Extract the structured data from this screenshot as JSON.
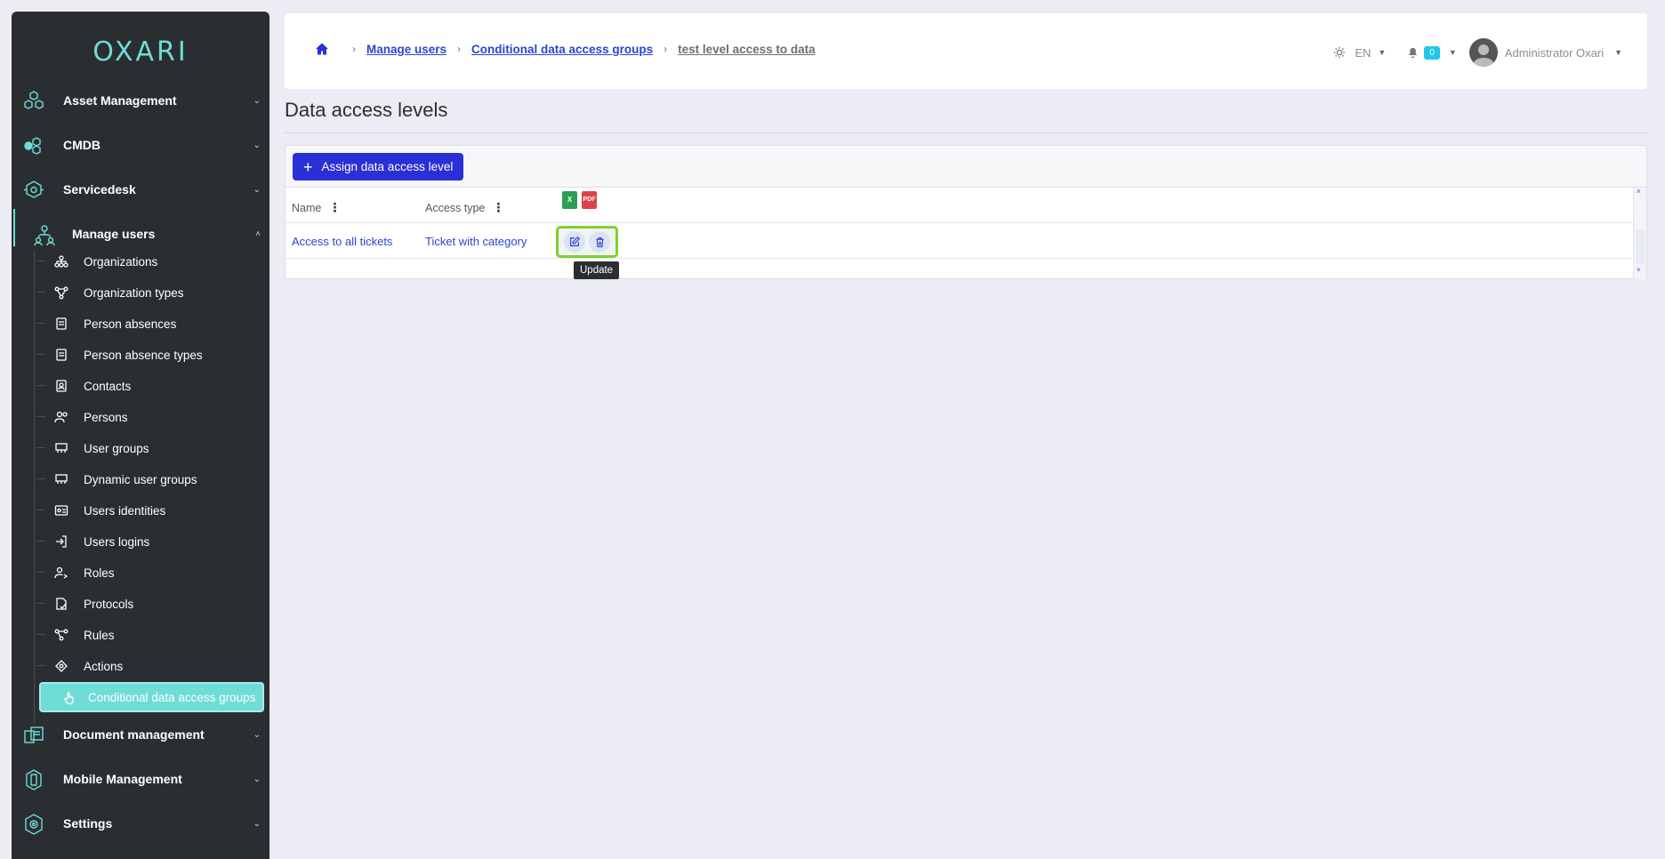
{
  "logo": "OXARI",
  "sidebar": {
    "sections": [
      {
        "label": "Asset Management",
        "icon": "hexagons-icon"
      },
      {
        "label": "CMDB",
        "icon": "cmdb-icon"
      },
      {
        "label": "Servicedesk",
        "icon": "eye-hexagon-icon"
      },
      {
        "label": "Manage users",
        "icon": "users-tree-icon"
      }
    ],
    "sub_items": [
      {
        "label": "Organizations",
        "icon": "org-chart-icon"
      },
      {
        "label": "Organization types",
        "icon": "org-types-icon"
      },
      {
        "label": "Person absences",
        "icon": "document-icon"
      },
      {
        "label": "Person absence types",
        "icon": "document-icon"
      },
      {
        "label": "Contacts",
        "icon": "contact-card-icon"
      },
      {
        "label": "Persons",
        "icon": "persons-icon"
      },
      {
        "label": "User groups",
        "icon": "user-groups-icon"
      },
      {
        "label": "Dynamic user groups",
        "icon": "user-groups-icon"
      },
      {
        "label": "Users identities",
        "icon": "id-card-icon"
      },
      {
        "label": "Users logins",
        "icon": "login-icon"
      },
      {
        "label": "Roles",
        "icon": "role-icon"
      },
      {
        "label": "Protocols",
        "icon": "protocol-icon"
      },
      {
        "label": "Rules",
        "icon": "rules-icon"
      },
      {
        "label": "Actions",
        "icon": "actions-icon"
      },
      {
        "label": "Conditional data access groups",
        "icon": "hand-pointer-icon"
      }
    ],
    "bottom_sections": [
      {
        "label": "Document management",
        "icon": "documents-icon"
      },
      {
        "label": "Mobile Management",
        "icon": "mobile-icon"
      },
      {
        "label": "Settings",
        "icon": "settings-gear-icon"
      }
    ]
  },
  "breadcrumb": {
    "items": [
      "Manage users",
      "Conditional data access groups"
    ],
    "current": "test level access to data"
  },
  "header": {
    "lang": "EN",
    "notifications": "0",
    "user": "Administrator Oxari"
  },
  "page": {
    "title": "Data access levels",
    "assign_button": "Assign data access level"
  },
  "table": {
    "columns": [
      "Name",
      "Access type"
    ],
    "export": {
      "excel": "X",
      "pdf": "PDF"
    },
    "rows": [
      {
        "name": "Access to all tickets",
        "access_type": "Ticket with category"
      }
    ],
    "tooltip": "Update"
  },
  "colors": {
    "sidebar_bg": "#2b2e31",
    "accent": "#6fdcd6",
    "primary": "#2a2fd6",
    "link": "#2a45d4",
    "highlight": "#7ed12a"
  }
}
